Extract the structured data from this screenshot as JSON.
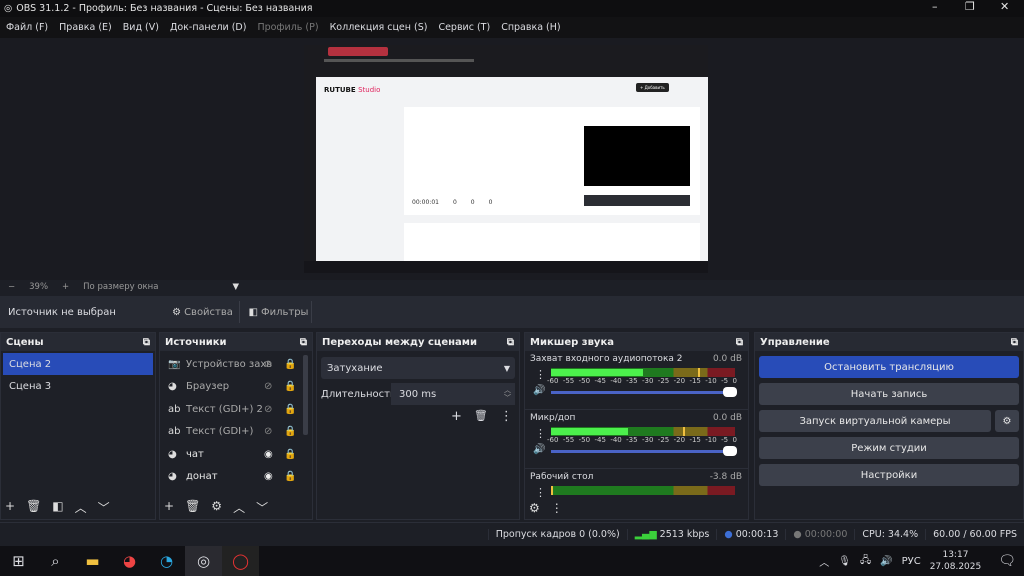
{
  "window": {
    "title": "OBS 31.1.2 - Профиль: Без названия - Сцены: Без названия",
    "controls": [
      "–",
      "❐",
      "✕"
    ]
  },
  "menu": [
    {
      "label": "Файл (F)",
      "enabled": true
    },
    {
      "label": "Правка (E)",
      "enabled": true
    },
    {
      "label": "Вид (V)",
      "enabled": true
    },
    {
      "label": "Док-панели (D)",
      "enabled": true
    },
    {
      "label": "Профиль (P)",
      "enabled": false
    },
    {
      "label": "Коллекция сцен (S)",
      "enabled": true
    },
    {
      "label": "Сервис (T)",
      "enabled": true
    },
    {
      "label": "Справка (H)",
      "enabled": true
    }
  ],
  "preview": {
    "brand": "RUTUBE",
    "brand2": "Studio",
    "add_label": "+ Добавить",
    "timer": "00:00:01",
    "count1": "0",
    "count2": "0",
    "count3": "0",
    "accent": "#e0245e"
  },
  "zoombar": {
    "minus": "−",
    "zoom": "39%",
    "plus": "+",
    "mode": "По размеру окна"
  },
  "context": {
    "no_source": "Источник не выбран",
    "properties": "Свойства",
    "filters": "Фильтры"
  },
  "scenes": {
    "title": "Сцены",
    "items": [
      "Сцена 2",
      "Сцена 3"
    ],
    "selected": 0
  },
  "sources": {
    "title": "Источники",
    "items": [
      {
        "name": "Устройство захв",
        "icon": "camera",
        "visible": false
      },
      {
        "name": "Браузер",
        "icon": "globe",
        "visible": false
      },
      {
        "name": "Текст (GDI+) 2",
        "icon": "text",
        "visible": false
      },
      {
        "name": "Текст (GDI+)",
        "icon": "text",
        "visible": false
      },
      {
        "name": "чат",
        "icon": "globe",
        "visible": true
      },
      {
        "name": "донат",
        "icon": "globe",
        "visible": true
      }
    ]
  },
  "transitions": {
    "title": "Переходы между сценами",
    "selected": "Затухание",
    "duration_label": "Длительность",
    "duration": "300 ms"
  },
  "mixer": {
    "title": "Микшер звука",
    "scale": [
      "-60",
      "-55",
      "-50",
      "-45",
      "-40",
      "-35",
      "-30",
      "-25",
      "-20",
      "-15",
      "-10",
      "-5",
      "0"
    ],
    "channels": [
      {
        "name": "Захват входного аудиопотока 2",
        "db": "0.0 dB",
        "level": -30,
        "peak": -12,
        "volume": 1.0
      },
      {
        "name": "Микр/доп",
        "db": "0.0 dB",
        "level": -35,
        "peak": -17,
        "volume": 1.0
      },
      {
        "name": "Рабочий стол",
        "db": "-3.8 dB",
        "level": -60,
        "peak": -60
      }
    ]
  },
  "controls": {
    "title": "Управление",
    "stop_stream": "Остановить трансляцию",
    "record": "Начать запись",
    "virtual_cam": "Запуск виртуальной камеры",
    "studio": "Режим студии",
    "settings": "Настройки",
    "accent": "#284cb8"
  },
  "status": {
    "dropped": "Пропуск кадров 0 (0.0%)",
    "bitrate": "2513 kbps",
    "stream_time": "00:00:13",
    "rec_time": "00:00:00",
    "cpu": "CPU: 34.4%",
    "fps": "60.00 / 60.00 FPS"
  },
  "taskbar": {
    "lang": "РУС",
    "time": "13:17",
    "date": "27.08.2025"
  }
}
